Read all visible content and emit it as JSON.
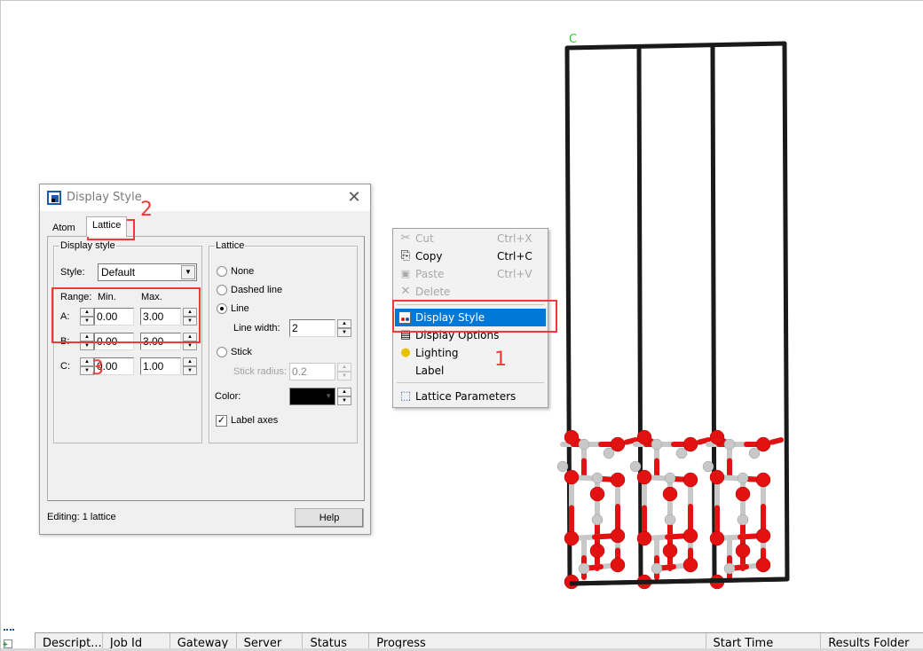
{
  "viewport": {
    "axis_label": "C",
    "axis_label_color": "#33cc33",
    "lattice_line_color": "#1a1a1a",
    "oxygen_color": "#e31212",
    "metal_color": "#c8c8c8"
  },
  "dialog": {
    "title": "Display Style",
    "close_icon": "close-icon",
    "tabs": [
      {
        "label": "Atom",
        "active": false
      },
      {
        "label": "Lattice",
        "active": true
      }
    ],
    "display_style_group": {
      "legend": "Display style",
      "style_label": "Style:",
      "style_value": "Default",
      "range_label": "Range:",
      "min_label": "Min.",
      "max_label": "Max.",
      "rows": [
        {
          "label": "A:",
          "min": "0.00",
          "max": "3.00"
        },
        {
          "label": "B:",
          "min": "0.00",
          "max": "3.00"
        },
        {
          "label": "C:",
          "min": "0.00",
          "max": "1.00"
        }
      ]
    },
    "lattice_group": {
      "legend": "Lattice",
      "options": [
        {
          "label": "None",
          "selected": false
        },
        {
          "label": "Dashed line",
          "selected": false
        },
        {
          "label": "Line",
          "selected": true
        },
        {
          "label": "Stick",
          "selected": false
        }
      ],
      "line_width_label": "Line width:",
      "line_width_value": "2",
      "stick_radius_label": "Stick radius:",
      "stick_radius_value": "0.2",
      "color_label": "Color:",
      "color_value": "#000000",
      "label_axes_label": "Label axes",
      "label_axes_checked": true
    },
    "status_text": "Editing: 1 lattice",
    "help_label": "Help"
  },
  "context_menu": {
    "items": [
      {
        "label": "Cut",
        "shortcut": "Ctrl+X",
        "icon": "scissors-icon",
        "glyph": "✂",
        "disabled": true
      },
      {
        "label": "Copy",
        "shortcut": "Ctrl+C",
        "icon": "copy-icon",
        "glyph": "⎘",
        "disabled": false
      },
      {
        "label": "Paste",
        "shortcut": "Ctrl+V",
        "icon": "paste-icon",
        "glyph": "📋",
        "disabled": true
      },
      {
        "label": "Delete",
        "shortcut": "",
        "icon": "delete-icon",
        "glyph": "✕",
        "disabled": true
      },
      {
        "label": "Display Style",
        "shortcut": "",
        "icon": "display-style-icon",
        "glyph": "🖌",
        "highlighted": true
      },
      {
        "label": "Display Options",
        "shortcut": "",
        "icon": "display-options-icon",
        "glyph": "▤"
      },
      {
        "label": "Lighting",
        "shortcut": "",
        "icon": "lightbulb-icon",
        "glyph": "💡"
      },
      {
        "label": "Label",
        "shortcut": "",
        "icon": "",
        "glyph": ""
      },
      {
        "label": "Lattice Parameters",
        "shortcut": "",
        "icon": "lattice-parameters-icon",
        "glyph": "⬚"
      }
    ],
    "highlight_color": "#0078d7"
  },
  "annotations": {
    "numbers": [
      "1",
      "2",
      "3"
    ],
    "color": "#f03a3a"
  },
  "job_panel": {
    "columns": [
      "Descript...",
      "Job Id",
      "Gateway",
      "Server",
      "Status",
      "Progress",
      "Start Time",
      "Results Folder"
    ]
  }
}
